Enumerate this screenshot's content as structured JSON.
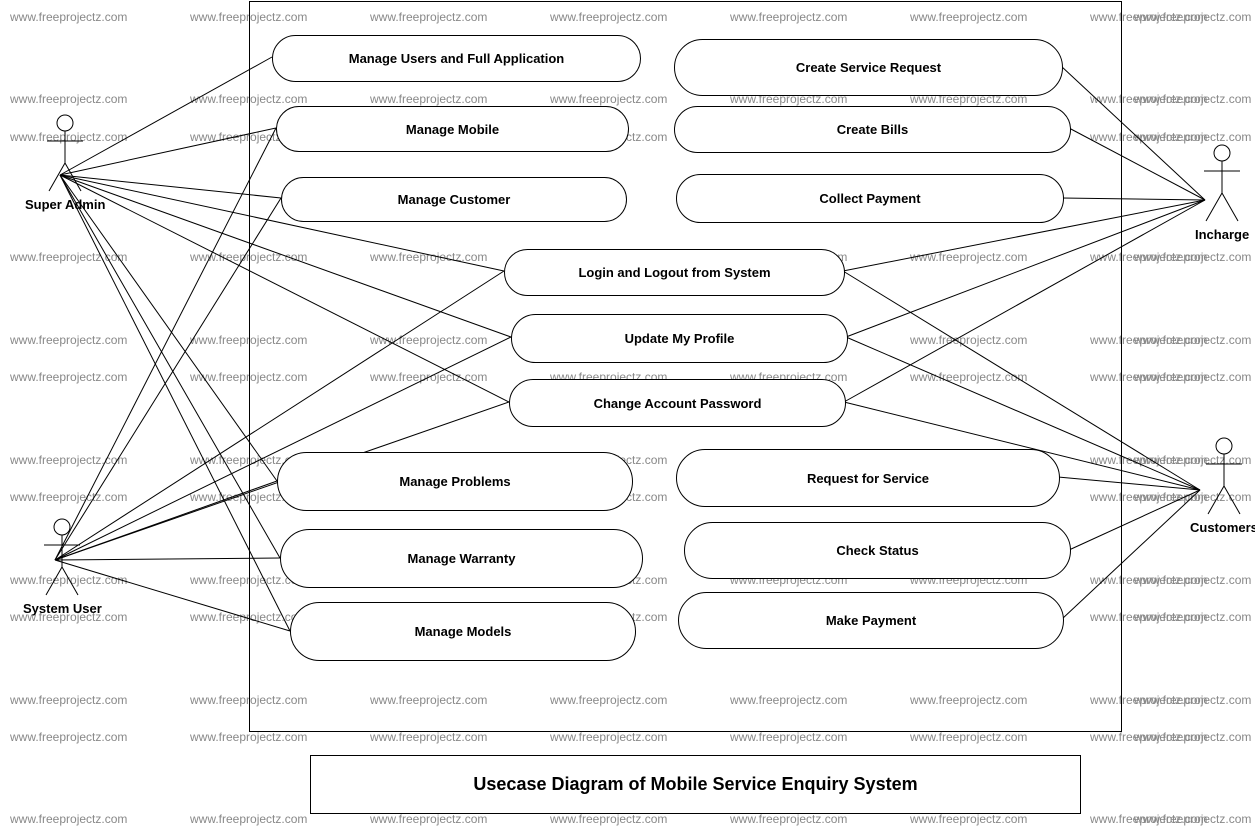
{
  "watermark_text": "www.freeprojectz.com",
  "title": "Usecase Diagram of Mobile Service Enquiry System",
  "actors": {
    "super_admin": "Super Admin",
    "system_user": "System User",
    "incharge": "Incharge",
    "customers": "Customers"
  },
  "usecases": {
    "manage_users": "Manage Users and Full Application",
    "manage_mobile": "Manage Mobile",
    "manage_customer": "Manage Customer",
    "create_service_request": "Create Service Request",
    "create_bills": "Create Bills",
    "collect_payment": "Collect Payment",
    "login_logout": "Login and Logout from System",
    "update_profile": "Update My Profile",
    "change_password": "Change Account Password",
    "manage_problems": "Manage Problems",
    "manage_warranty": "Manage Warranty",
    "manage_models": "Manage Models",
    "request_service": "Request for Service",
    "check_status": "Check Status",
    "make_payment": "Make Payment"
  },
  "chart_data": {
    "type": "usecase-diagram",
    "system": "Mobile Service Enquiry System",
    "actors": [
      {
        "name": "Super Admin",
        "side": "left"
      },
      {
        "name": "System User",
        "side": "left"
      },
      {
        "name": "Incharge",
        "side": "right"
      },
      {
        "name": "Customers",
        "side": "right"
      }
    ],
    "usecases": [
      "Manage Users and Full Application",
      "Manage Mobile",
      "Manage Customer",
      "Create Service Request",
      "Create Bills",
      "Collect Payment",
      "Login and Logout from System",
      "Update My Profile",
      "Change Account Password",
      "Manage Problems",
      "Manage Warranty",
      "Manage Models",
      "Request for Service",
      "Check Status",
      "Make Payment"
    ],
    "associations": [
      {
        "actor": "Super Admin",
        "usecase": "Manage Users and Full Application"
      },
      {
        "actor": "Super Admin",
        "usecase": "Manage Mobile"
      },
      {
        "actor": "Super Admin",
        "usecase": "Manage Customer"
      },
      {
        "actor": "Super Admin",
        "usecase": "Login and Logout from System"
      },
      {
        "actor": "Super Admin",
        "usecase": "Update My Profile"
      },
      {
        "actor": "Super Admin",
        "usecase": "Change Account Password"
      },
      {
        "actor": "Super Admin",
        "usecase": "Manage Problems"
      },
      {
        "actor": "Super Admin",
        "usecase": "Manage Warranty"
      },
      {
        "actor": "Super Admin",
        "usecase": "Manage Models"
      },
      {
        "actor": "System User",
        "usecase": "Manage Mobile"
      },
      {
        "actor": "System User",
        "usecase": "Manage Customer"
      },
      {
        "actor": "System User",
        "usecase": "Login and Logout from System"
      },
      {
        "actor": "System User",
        "usecase": "Update My Profile"
      },
      {
        "actor": "System User",
        "usecase": "Change Account Password"
      },
      {
        "actor": "System User",
        "usecase": "Manage Problems"
      },
      {
        "actor": "System User",
        "usecase": "Manage Warranty"
      },
      {
        "actor": "System User",
        "usecase": "Manage Models"
      },
      {
        "actor": "Incharge",
        "usecase": "Create Service Request"
      },
      {
        "actor": "Incharge",
        "usecase": "Create Bills"
      },
      {
        "actor": "Incharge",
        "usecase": "Collect Payment"
      },
      {
        "actor": "Incharge",
        "usecase": "Login and Logout from System"
      },
      {
        "actor": "Incharge",
        "usecase": "Update My Profile"
      },
      {
        "actor": "Incharge",
        "usecase": "Change Account Password"
      },
      {
        "actor": "Customers",
        "usecase": "Login and Logout from System"
      },
      {
        "actor": "Customers",
        "usecase": "Update My Profile"
      },
      {
        "actor": "Customers",
        "usecase": "Change Account Password"
      },
      {
        "actor": "Customers",
        "usecase": "Request for Service"
      },
      {
        "actor": "Customers",
        "usecase": "Check Status"
      },
      {
        "actor": "Customers",
        "usecase": "Make Payment"
      }
    ]
  }
}
